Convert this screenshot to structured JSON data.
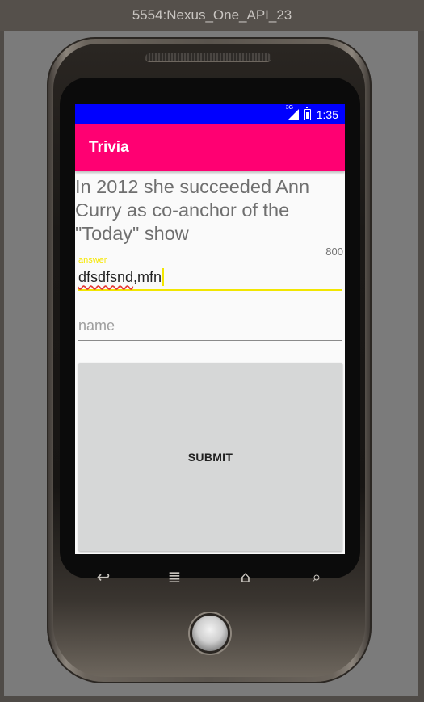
{
  "window": {
    "title": "5554:Nexus_One_API_23"
  },
  "statusbar": {
    "network": "3G",
    "time": "1:35",
    "color": "#0000ff"
  },
  "app": {
    "title": "Trivia",
    "accent_color": "#ff0072",
    "question": "In 2012 she succeeded Ann Curry as co-anchor of the \"Today\" show",
    "points": "800",
    "answer_field": {
      "label": "answer",
      "value_misspelled": "dfsdfsnd",
      "value_rest": ",mfn"
    },
    "name_field": {
      "placeholder": "name",
      "value": ""
    },
    "submit_label": "SUBMIT"
  },
  "hardware_keys": {
    "back_icon": "↩",
    "menu_icon": "≣",
    "home_icon": "⌂",
    "search_icon": "⌕"
  }
}
